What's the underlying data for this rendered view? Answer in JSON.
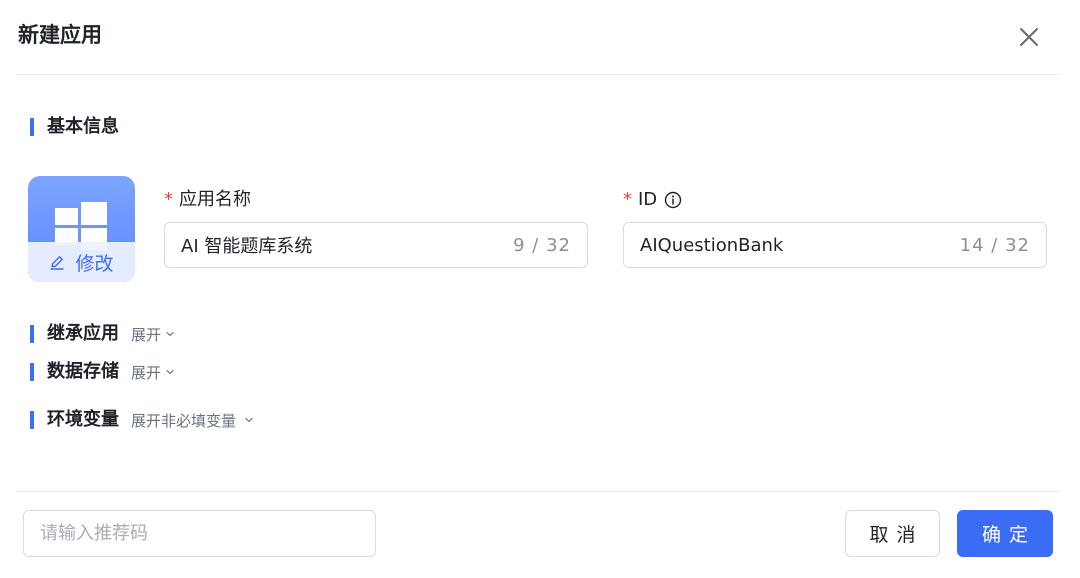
{
  "dialog": {
    "title": "新建应用",
    "close_icon": "close-icon"
  },
  "basic_info": {
    "title": "基本信息",
    "app_icon": {
      "icon": "windows-logo-icon",
      "edit_label": "修改"
    },
    "app_name": {
      "required_mark": "*",
      "label": "应用名称",
      "value": "AI 智能题库系统",
      "counter": "9 / 32"
    },
    "app_id": {
      "required_mark": "*",
      "label": "ID",
      "value": "AIQuestionBank",
      "counter": "14 / 32"
    }
  },
  "inherit_app": {
    "title": "继承应用",
    "toggle_label": "展开"
  },
  "data_storage": {
    "title": "数据存储",
    "toggle_label": "展开"
  },
  "env_vars": {
    "title": "环境变量",
    "toggle_label": "展开非必填变量"
  },
  "footer": {
    "referral_placeholder": "请输入推荐码",
    "cancel_label": "取消",
    "confirm_label": "确定"
  },
  "colors": {
    "accent": "#3b6cf6",
    "required": "#f04438",
    "border": "#d7dbe2"
  }
}
